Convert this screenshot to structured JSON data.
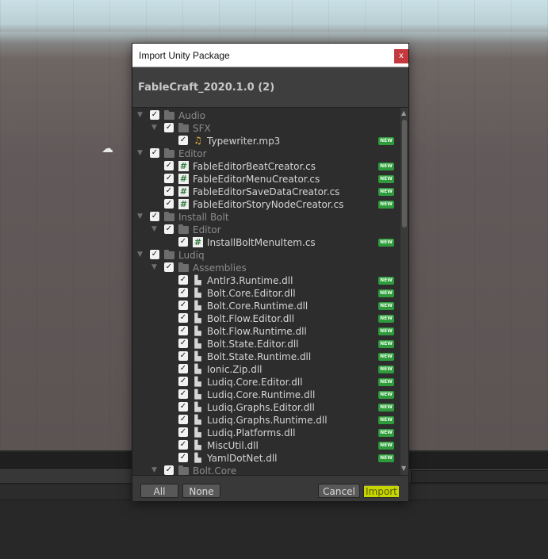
{
  "dialog": {
    "title": "Import Unity Package",
    "close_label": "x",
    "package_name": "FableCraft_2020.1.0 (2)"
  },
  "badge_label": "NEW",
  "tree": [
    {
      "level": 0,
      "type": "folder",
      "label": "Audio"
    },
    {
      "level": 1,
      "type": "folder",
      "label": "SFX"
    },
    {
      "level": 2,
      "type": "audio",
      "label": "Typewriter.mp3",
      "new": true
    },
    {
      "level": 0,
      "type": "folder",
      "label": "Editor"
    },
    {
      "level": 1,
      "type": "cs",
      "label": "FableEditorBeatCreator.cs",
      "new": true
    },
    {
      "level": 1,
      "type": "cs",
      "label": "FableEditorMenuCreator.cs",
      "new": true
    },
    {
      "level": 1,
      "type": "cs",
      "label": "FableEditorSaveDataCreator.cs",
      "new": true
    },
    {
      "level": 1,
      "type": "cs",
      "label": "FableEditorStoryNodeCreator.cs",
      "new": true
    },
    {
      "level": 0,
      "type": "folder",
      "label": "Install Bolt"
    },
    {
      "level": 1,
      "type": "folder",
      "label": "Editor"
    },
    {
      "level": 2,
      "type": "cs",
      "label": "InstallBoltMenuItem.cs",
      "new": true
    },
    {
      "level": 0,
      "type": "folder",
      "label": "Ludiq"
    },
    {
      "level": 1,
      "type": "folder",
      "label": "Assemblies"
    },
    {
      "level": 2,
      "type": "dll",
      "label": "Antlr3.Runtime.dll",
      "new": true
    },
    {
      "level": 2,
      "type": "dll",
      "label": "Bolt.Core.Editor.dll",
      "new": true
    },
    {
      "level": 2,
      "type": "dll",
      "label": "Bolt.Core.Runtime.dll",
      "new": true
    },
    {
      "level": 2,
      "type": "dll",
      "label": "Bolt.Flow.Editor.dll",
      "new": true
    },
    {
      "level": 2,
      "type": "dll",
      "label": "Bolt.Flow.Runtime.dll",
      "new": true
    },
    {
      "level": 2,
      "type": "dll",
      "label": "Bolt.State.Editor.dll",
      "new": true
    },
    {
      "level": 2,
      "type": "dll",
      "label": "Bolt.State.Runtime.dll",
      "new": true
    },
    {
      "level": 2,
      "type": "dll",
      "label": "Ionic.Zip.dll",
      "new": true
    },
    {
      "level": 2,
      "type": "dll",
      "label": "Ludiq.Core.Editor.dll",
      "new": true
    },
    {
      "level": 2,
      "type": "dll",
      "label": "Ludiq.Core.Runtime.dll",
      "new": true
    },
    {
      "level": 2,
      "type": "dll",
      "label": "Ludiq.Graphs.Editor.dll",
      "new": true
    },
    {
      "level": 2,
      "type": "dll",
      "label": "Ludiq.Graphs.Runtime.dll",
      "new": true
    },
    {
      "level": 2,
      "type": "dll",
      "label": "Ludiq.Platforms.dll",
      "new": true
    },
    {
      "level": 2,
      "type": "dll",
      "label": "MiscUtil.dll",
      "new": true
    },
    {
      "level": 2,
      "type": "dll",
      "label": "YamlDotNet.dll",
      "new": true
    },
    {
      "level": 1,
      "type": "folder",
      "label": "Bolt.Core"
    }
  ],
  "footer": {
    "all_label": "All",
    "none_label": "None",
    "cancel_label": "Cancel",
    "import_label": "Import"
  }
}
